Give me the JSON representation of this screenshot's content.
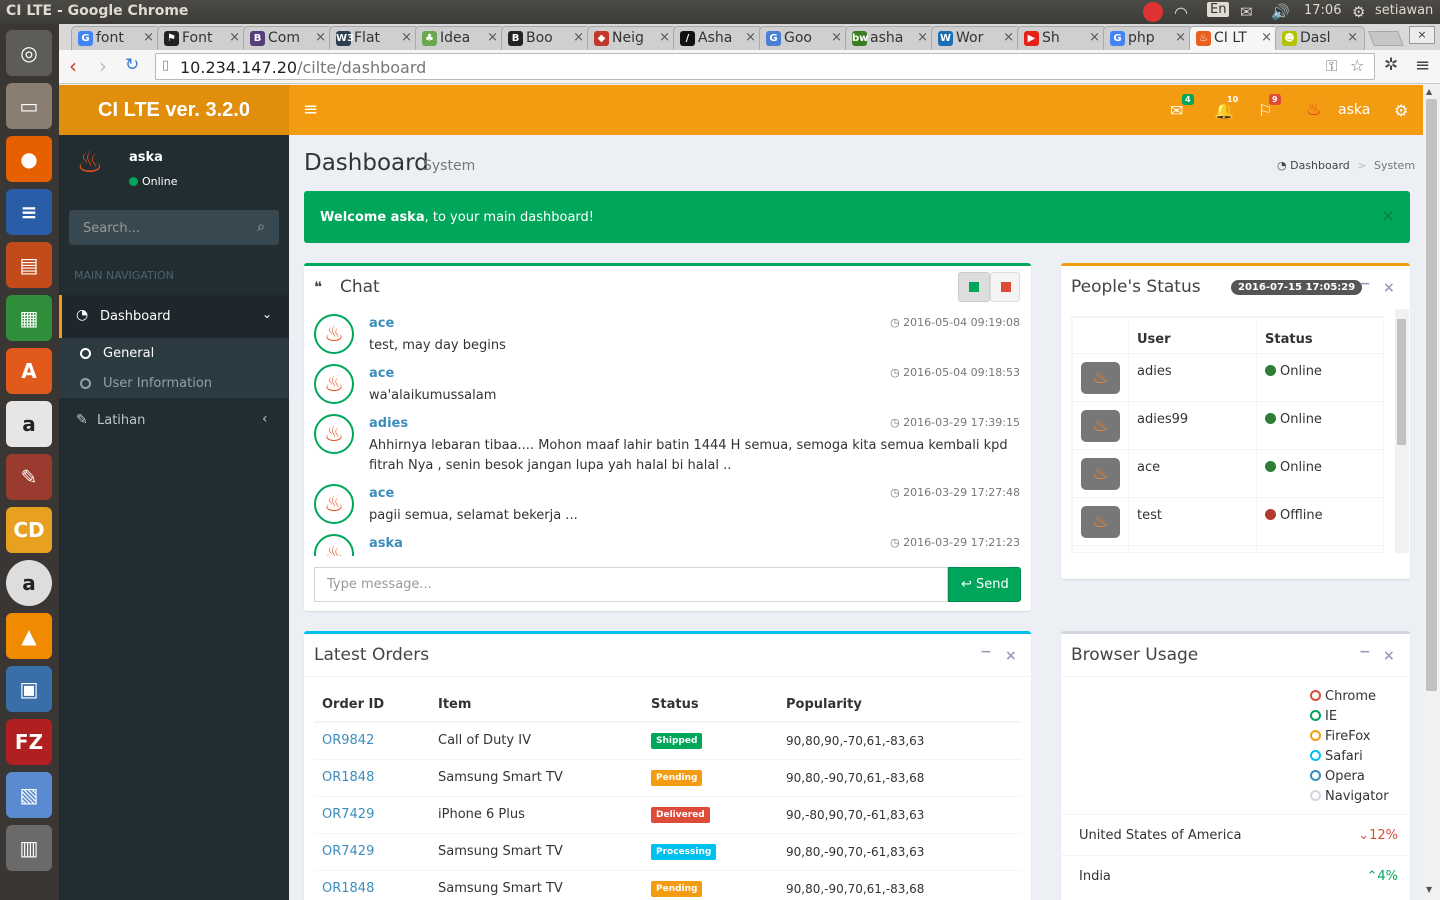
{
  "os": {
    "window_title": "CI LTE - Google Chrome",
    "lang": "En",
    "clock": "17:06",
    "user": "setiawan"
  },
  "tabs": [
    {
      "label": "font",
      "fav": "G",
      "color": "#4285f4"
    },
    {
      "label": "Font",
      "fav": "⚑",
      "color": "#222"
    },
    {
      "label": "Com",
      "fav": "B",
      "color": "#563d7c"
    },
    {
      "label": "Flat",
      "fav": "W3",
      "color": "#2d3e50"
    },
    {
      "label": "Idea",
      "fav": "♣",
      "color": "#6aa84f"
    },
    {
      "label": "Boo",
      "fav": "B",
      "color": "#222"
    },
    {
      "label": "Neig",
      "fav": "◆",
      "color": "#c0392b"
    },
    {
      "label": "Asha",
      "fav": "/",
      "color": "#111"
    },
    {
      "label": "Goo",
      "fav": "G",
      "color": "#4a7fd6"
    },
    {
      "label": "asha",
      "fav": "bw",
      "color": "#3b7d23"
    },
    {
      "label": "Wor",
      "fav": "W",
      "color": "#1a6fb5"
    },
    {
      "label": "Sh",
      "fav": "▶",
      "color": "#e62117"
    },
    {
      "label": "php",
      "fav": "G",
      "color": "#4285f4"
    },
    {
      "label": "CI LT",
      "fav": "♨",
      "color": "#e8601c"
    },
    {
      "label": "Dasl",
      "fav": "☻",
      "color": "#b5c200"
    }
  ],
  "address": {
    "host": "10.234.147.20",
    "path": "/cilte/dashboard"
  },
  "app": {
    "logo": "CI LTE ver. 3.2.0",
    "navbar": {
      "mail_count": "4",
      "notif_count": "10",
      "flag_count": "9",
      "user": "aska"
    }
  },
  "sidebar": {
    "user": "aska",
    "status": "Online",
    "search_placeholder": "Search...",
    "header": "MAIN NAVIGATION",
    "items": [
      {
        "label": "Dashboard"
      },
      {
        "label": "General"
      },
      {
        "label": "User Information"
      },
      {
        "label": "Latihan"
      }
    ]
  },
  "page": {
    "title": "Dashboard",
    "subtitle": "System",
    "breadcrumb": [
      "Dashboard",
      "System"
    ],
    "welcome_bold": "Welcome aska",
    "welcome_rest": ", to your main dashboard!",
    "welcome_close": "×"
  },
  "chat": {
    "title": "Chat",
    "messages": [
      {
        "name": "ace",
        "time": "2016-05-04 09:19:08",
        "text": "test, may day begins"
      },
      {
        "name": "ace",
        "time": "2016-05-04 09:18:53",
        "text": "wa'alaikumussalam"
      },
      {
        "name": "adies",
        "time": "2016-03-29 17:39:15",
        "text": "Ahhirnya lebaran tibaa.... Mohon maaf lahir batin 1444 H semua, semoga kita semua kembali kpd fitrah Nya , senin besok jangan lupa yah halal bi halal .."
      },
      {
        "name": "ace",
        "time": "2016-03-29 17:27:48",
        "text": "pagii semua, selamat bekerja ..."
      },
      {
        "name": "aska",
        "time": "2016-03-29 17:21:23",
        "text": ""
      }
    ],
    "input_placeholder": "Type message...",
    "send_label": "Send"
  },
  "people": {
    "title": "People's Status",
    "timestamp": "2016-07-15 17:05:29",
    "col_user": "User",
    "col_status": "Status",
    "rows": [
      {
        "user": "adies",
        "status": "Online",
        "color": "#2e7d32"
      },
      {
        "user": "adies99",
        "status": "Online",
        "color": "#2e7d32"
      },
      {
        "user": "ace",
        "status": "Online",
        "color": "#2e7d32"
      },
      {
        "user": "test",
        "status": "Offline",
        "color": "#b03a2e"
      }
    ]
  },
  "orders": {
    "title": "Latest Orders",
    "headers": [
      "Order ID",
      "Item",
      "Status",
      "Popularity"
    ],
    "rows": [
      {
        "id": "OR9842",
        "item": "Call of Duty IV",
        "status": "Shipped",
        "color": "#00a65a",
        "pop": "90,80,90,-70,61,-83,63"
      },
      {
        "id": "OR1848",
        "item": "Samsung Smart TV",
        "status": "Pending",
        "color": "#f39c12",
        "pop": "90,80,-90,70,61,-83,68"
      },
      {
        "id": "OR7429",
        "item": "iPhone 6 Plus",
        "status": "Delivered",
        "color": "#dd4b39",
        "pop": "90,-80,90,70,-61,83,63"
      },
      {
        "id": "OR7429",
        "item": "Samsung Smart TV",
        "status": "Processing",
        "color": "#00c0ef",
        "pop": "90,80,-90,70,-61,83,63"
      },
      {
        "id": "OR1848",
        "item": "Samsung Smart TV",
        "status": "Pending",
        "color": "#f39c12",
        "pop": "90,80,-90,70,61,-83,68"
      }
    ]
  },
  "browser": {
    "title": "Browser Usage",
    "legend": [
      {
        "label": "Chrome",
        "color": "#dd4b39"
      },
      {
        "label": "IE",
        "color": "#00a65a"
      },
      {
        "label": "FireFox",
        "color": "#f39c12"
      },
      {
        "label": "Safari",
        "color": "#00c0ef"
      },
      {
        "label": "Opera",
        "color": "#3c8dbc"
      },
      {
        "label": "Navigator",
        "color": "#d2d6de"
      }
    ],
    "countries": [
      {
        "name": "United States of America",
        "value": "12%",
        "dir": "down",
        "color": "#dd4b39"
      },
      {
        "name": "India",
        "value": "4%",
        "dir": "up",
        "color": "#00a65a"
      }
    ]
  }
}
